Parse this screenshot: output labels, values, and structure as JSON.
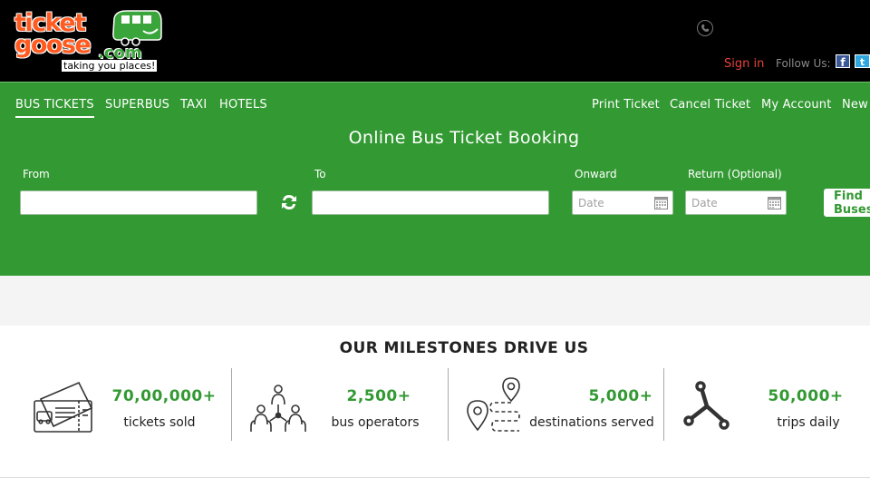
{
  "header": {
    "logo": {
      "word_top": "ticket",
      "word_bottom": "goose",
      "dotcom": ".com",
      "tagline": "taking you places!"
    },
    "sign_in": "Sign in",
    "follow_us": "Follow Us:",
    "social": {
      "facebook": "f",
      "twitter": "t"
    }
  },
  "nav": {
    "left": [
      "BUS TICKETS",
      "SUPERBUS",
      "TAXI",
      "HOTELS"
    ],
    "right": [
      "Print Ticket",
      "Cancel Ticket",
      "My Account",
      "New"
    ]
  },
  "booking": {
    "title": "Online Bus Ticket Booking",
    "from_label": "From",
    "to_label": "To",
    "onward_label": "Onward",
    "return_label": "Return (Optional)",
    "date_placeholder": "Date",
    "find_button": "Find Buses"
  },
  "milestones": {
    "title": "OUR MILESTONES DRIVE US",
    "items": [
      {
        "value": "70,00,000+",
        "label": "tickets sold",
        "icon": "ticket-icon"
      },
      {
        "value": "2,500+",
        "label": "bus operators",
        "icon": "operators-icon"
      },
      {
        "value": "5,000+",
        "label": "destinations served",
        "icon": "route-pin-icon"
      },
      {
        "value": "50,000+",
        "label": "trips daily",
        "icon": "trips-icon"
      }
    ]
  },
  "colors": {
    "brand_green": "#339933",
    "header_black": "#000000",
    "sign_in_red": "#e8423a",
    "logo_orange": "#ff5a1f"
  }
}
